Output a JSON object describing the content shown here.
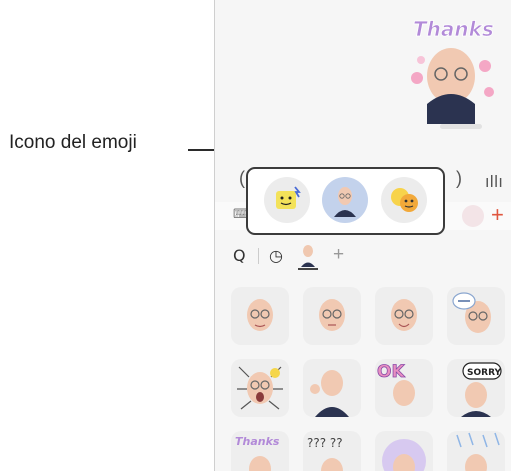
{
  "callout": {
    "label": "Icono del emoji"
  },
  "sticker_sent": {
    "word": "Thanks"
  },
  "composer": {
    "left_glyph": "(",
    "right_glyph": ")",
    "voice_glyph": "ıllı"
  },
  "tray": {
    "keyboard_glyph": "⌨",
    "plus_glyph": "+"
  },
  "sticker_toolbar": {
    "search_glyph": "Q",
    "clock_glyph": "◷",
    "add_glyph": "+"
  },
  "sticker_texts": {
    "ok": "OK",
    "sorry": "SORRY",
    "thanks": "Thanks",
    "question_marks": "??? ??"
  },
  "colors": {
    "accent_plus": "#e0563f",
    "selected_tab": "#c3d2ec",
    "callout_frame": "#3c3c3c"
  },
  "icons": [
    "emoji-icon",
    "avatar-icon",
    "mask-icon",
    "search-icon",
    "clock-icon",
    "add-icon",
    "keyboard-icon",
    "voice-icon"
  ]
}
